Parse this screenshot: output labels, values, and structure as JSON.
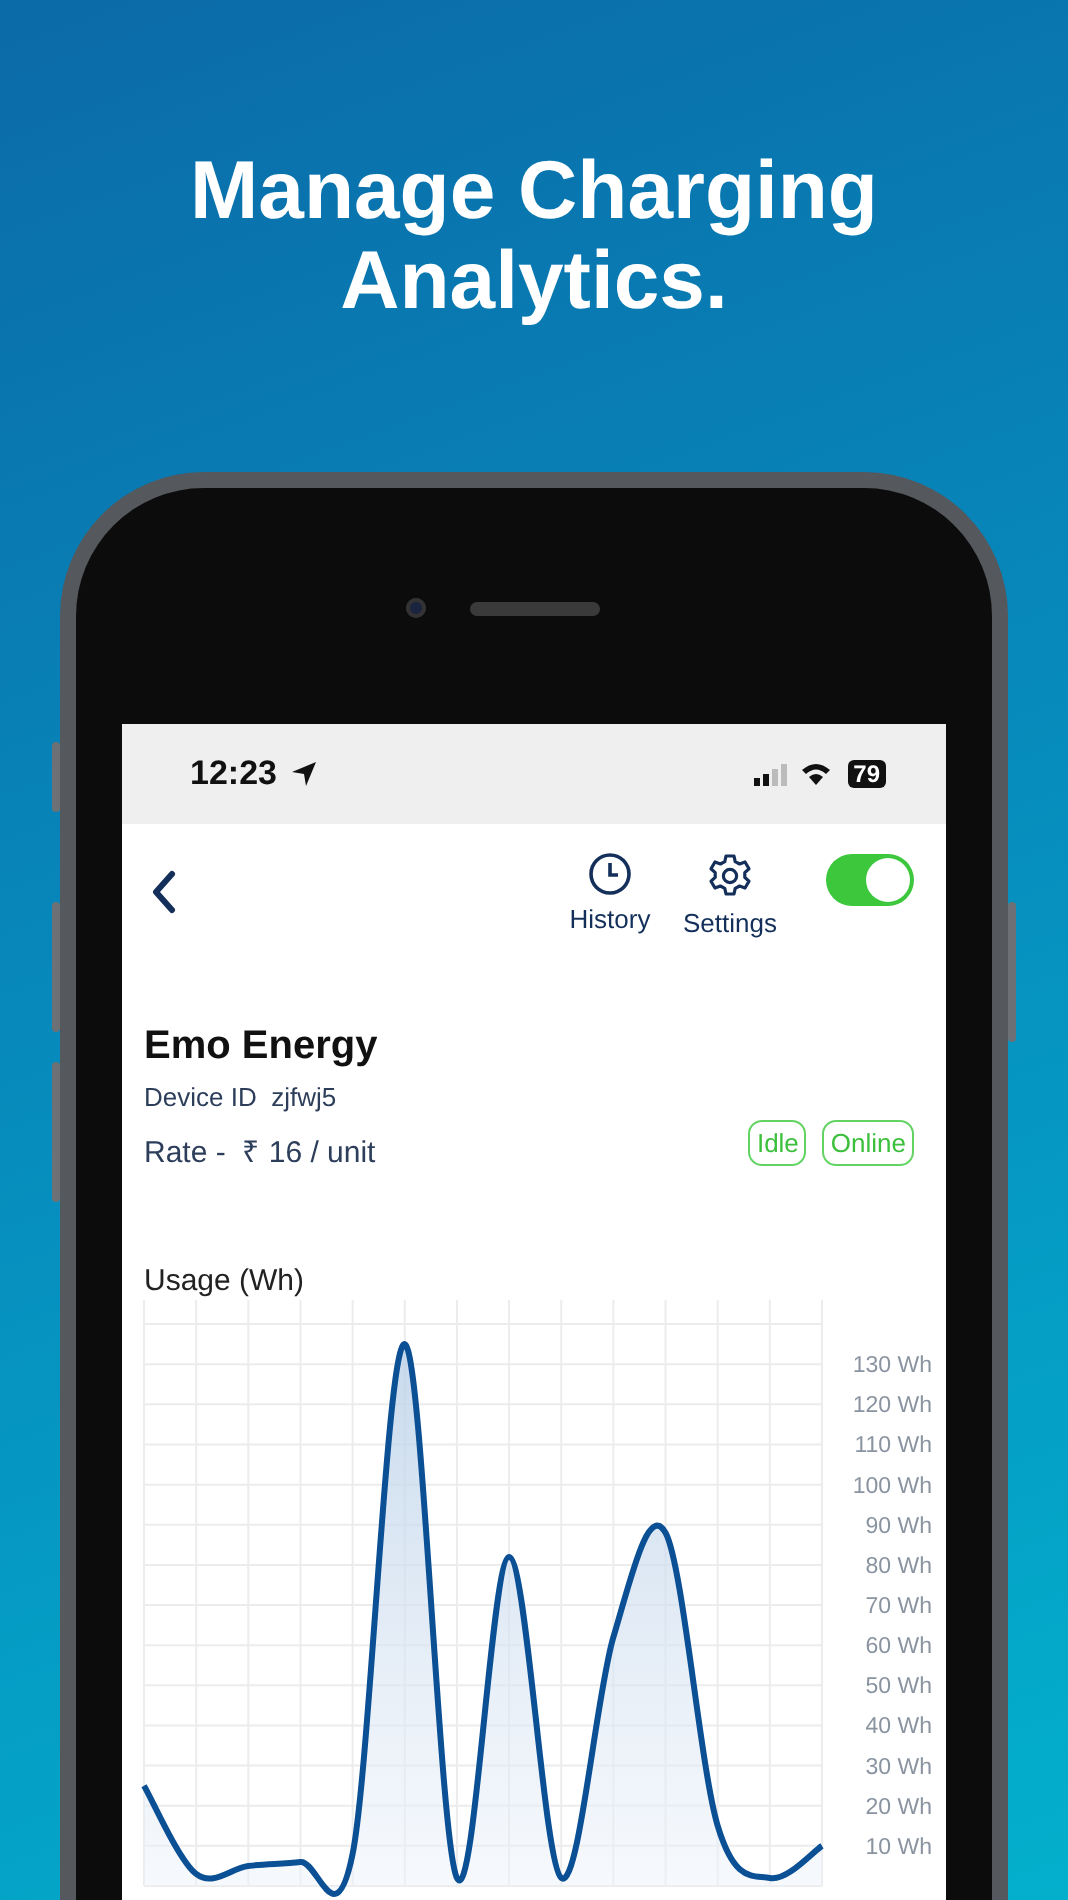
{
  "headline": "Manage Charging Analytics.",
  "status_bar": {
    "time": "12:23",
    "battery": "79"
  },
  "toolbar": {
    "actions": [
      {
        "kind": "history",
        "label": "History"
      },
      {
        "kind": "settings",
        "label": "Settings"
      }
    ],
    "power_toggle": {
      "on": true
    }
  },
  "device": {
    "name": "Emo Energy",
    "device_id": "Device ID  zjfwj5",
    "rate": "Rate -  ₹ 16 / unit",
    "badges": [
      {
        "label": "Idle"
      },
      {
        "label": "Online"
      }
    ]
  },
  "usage": {
    "title": "Usage (Wh)",
    "chart_data": {
      "type": "area",
      "grid": true,
      "series": [
        {
          "color": "#0b4f94",
          "values": [
            25,
            3,
            5,
            6,
            8,
            135,
            2,
            82,
            2,
            62,
            88,
            15,
            2,
            10
          ]
        }
      ],
      "ylim": [
        0,
        146
      ],
      "yticks": [
        {
          "value": 10,
          "label": "10 Wh"
        },
        {
          "value": 20,
          "label": "20 Wh"
        },
        {
          "value": 30,
          "label": "30 Wh"
        },
        {
          "value": 40,
          "label": "40 Wh"
        },
        {
          "value": 50,
          "label": "50 Wh"
        },
        {
          "value": 60,
          "label": "60 Wh"
        },
        {
          "value": 70,
          "label": "70 Wh"
        },
        {
          "value": 80,
          "label": "80 Wh"
        },
        {
          "value": 90,
          "label": "90 Wh"
        },
        {
          "value": 100,
          "label": "100 Wh"
        },
        {
          "value": 110,
          "label": "110 Wh"
        },
        {
          "value": 120,
          "label": "120 Wh"
        },
        {
          "value": 130,
          "label": "130 Wh"
        }
      ]
    }
  }
}
